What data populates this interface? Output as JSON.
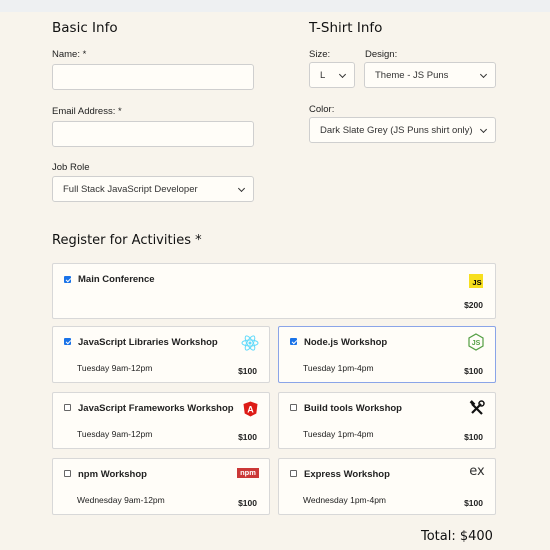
{
  "basic": {
    "title": "Basic Info",
    "name_label": "Name: *",
    "name_value": "",
    "email_label": "Email Address: *",
    "email_value": "",
    "role_label": "Job Role",
    "role_value": "Full Stack JavaScript Developer"
  },
  "shirt": {
    "title": "T-Shirt Info",
    "size_label": "Size:",
    "size_value": "L",
    "design_label": "Design:",
    "design_value": "Theme - JS Puns",
    "color_label": "Color:",
    "color_value": "Dark Slate Grey (JS Puns shirt only)"
  },
  "activities": {
    "title": "Register for Activities *",
    "items": [
      {
        "name": "Main Conference",
        "time": "",
        "price": "$200",
        "checked": true,
        "icon": "js-icon"
      },
      {
        "name": "JavaScript Libraries Workshop",
        "time": "Tuesday 9am-12pm",
        "price": "$100",
        "checked": true,
        "icon": "react-icon"
      },
      {
        "name": "Node.js Workshop",
        "time": "Tuesday 1pm-4pm",
        "price": "$100",
        "checked": true,
        "icon": "nodejs-icon"
      },
      {
        "name": "JavaScript Frameworks Workshop",
        "time": "Tuesday 9am-12pm",
        "price": "$100",
        "checked": false,
        "icon": "angular-icon"
      },
      {
        "name": "Build tools Workshop",
        "time": "Tuesday 1pm-4pm",
        "price": "$100",
        "checked": false,
        "icon": "tools-icon"
      },
      {
        "name": "npm Workshop",
        "time": "Wednesday 9am-12pm",
        "price": "$100",
        "checked": false,
        "icon": "npm-icon"
      },
      {
        "name": "Express Workshop",
        "time": "Wednesday 1pm-4pm",
        "price": "$100",
        "checked": false,
        "icon": "express-icon"
      }
    ]
  },
  "icons": {
    "js_text": "JS",
    "npm_text": "npm",
    "express_text": "ex",
    "angular_text": "A"
  },
  "total": "Total: $400",
  "colors": {
    "background": "#f8f4ec",
    "input_bg": "#fffdf8",
    "checkbox": "#1a73e8",
    "focus_border": "#8aa4e8",
    "js_yellow": "#f7df1e",
    "angular_red": "#dd1b16",
    "npm_red": "#cb3837",
    "react_blue": "#61dafb",
    "node_green": "#539e43"
  }
}
